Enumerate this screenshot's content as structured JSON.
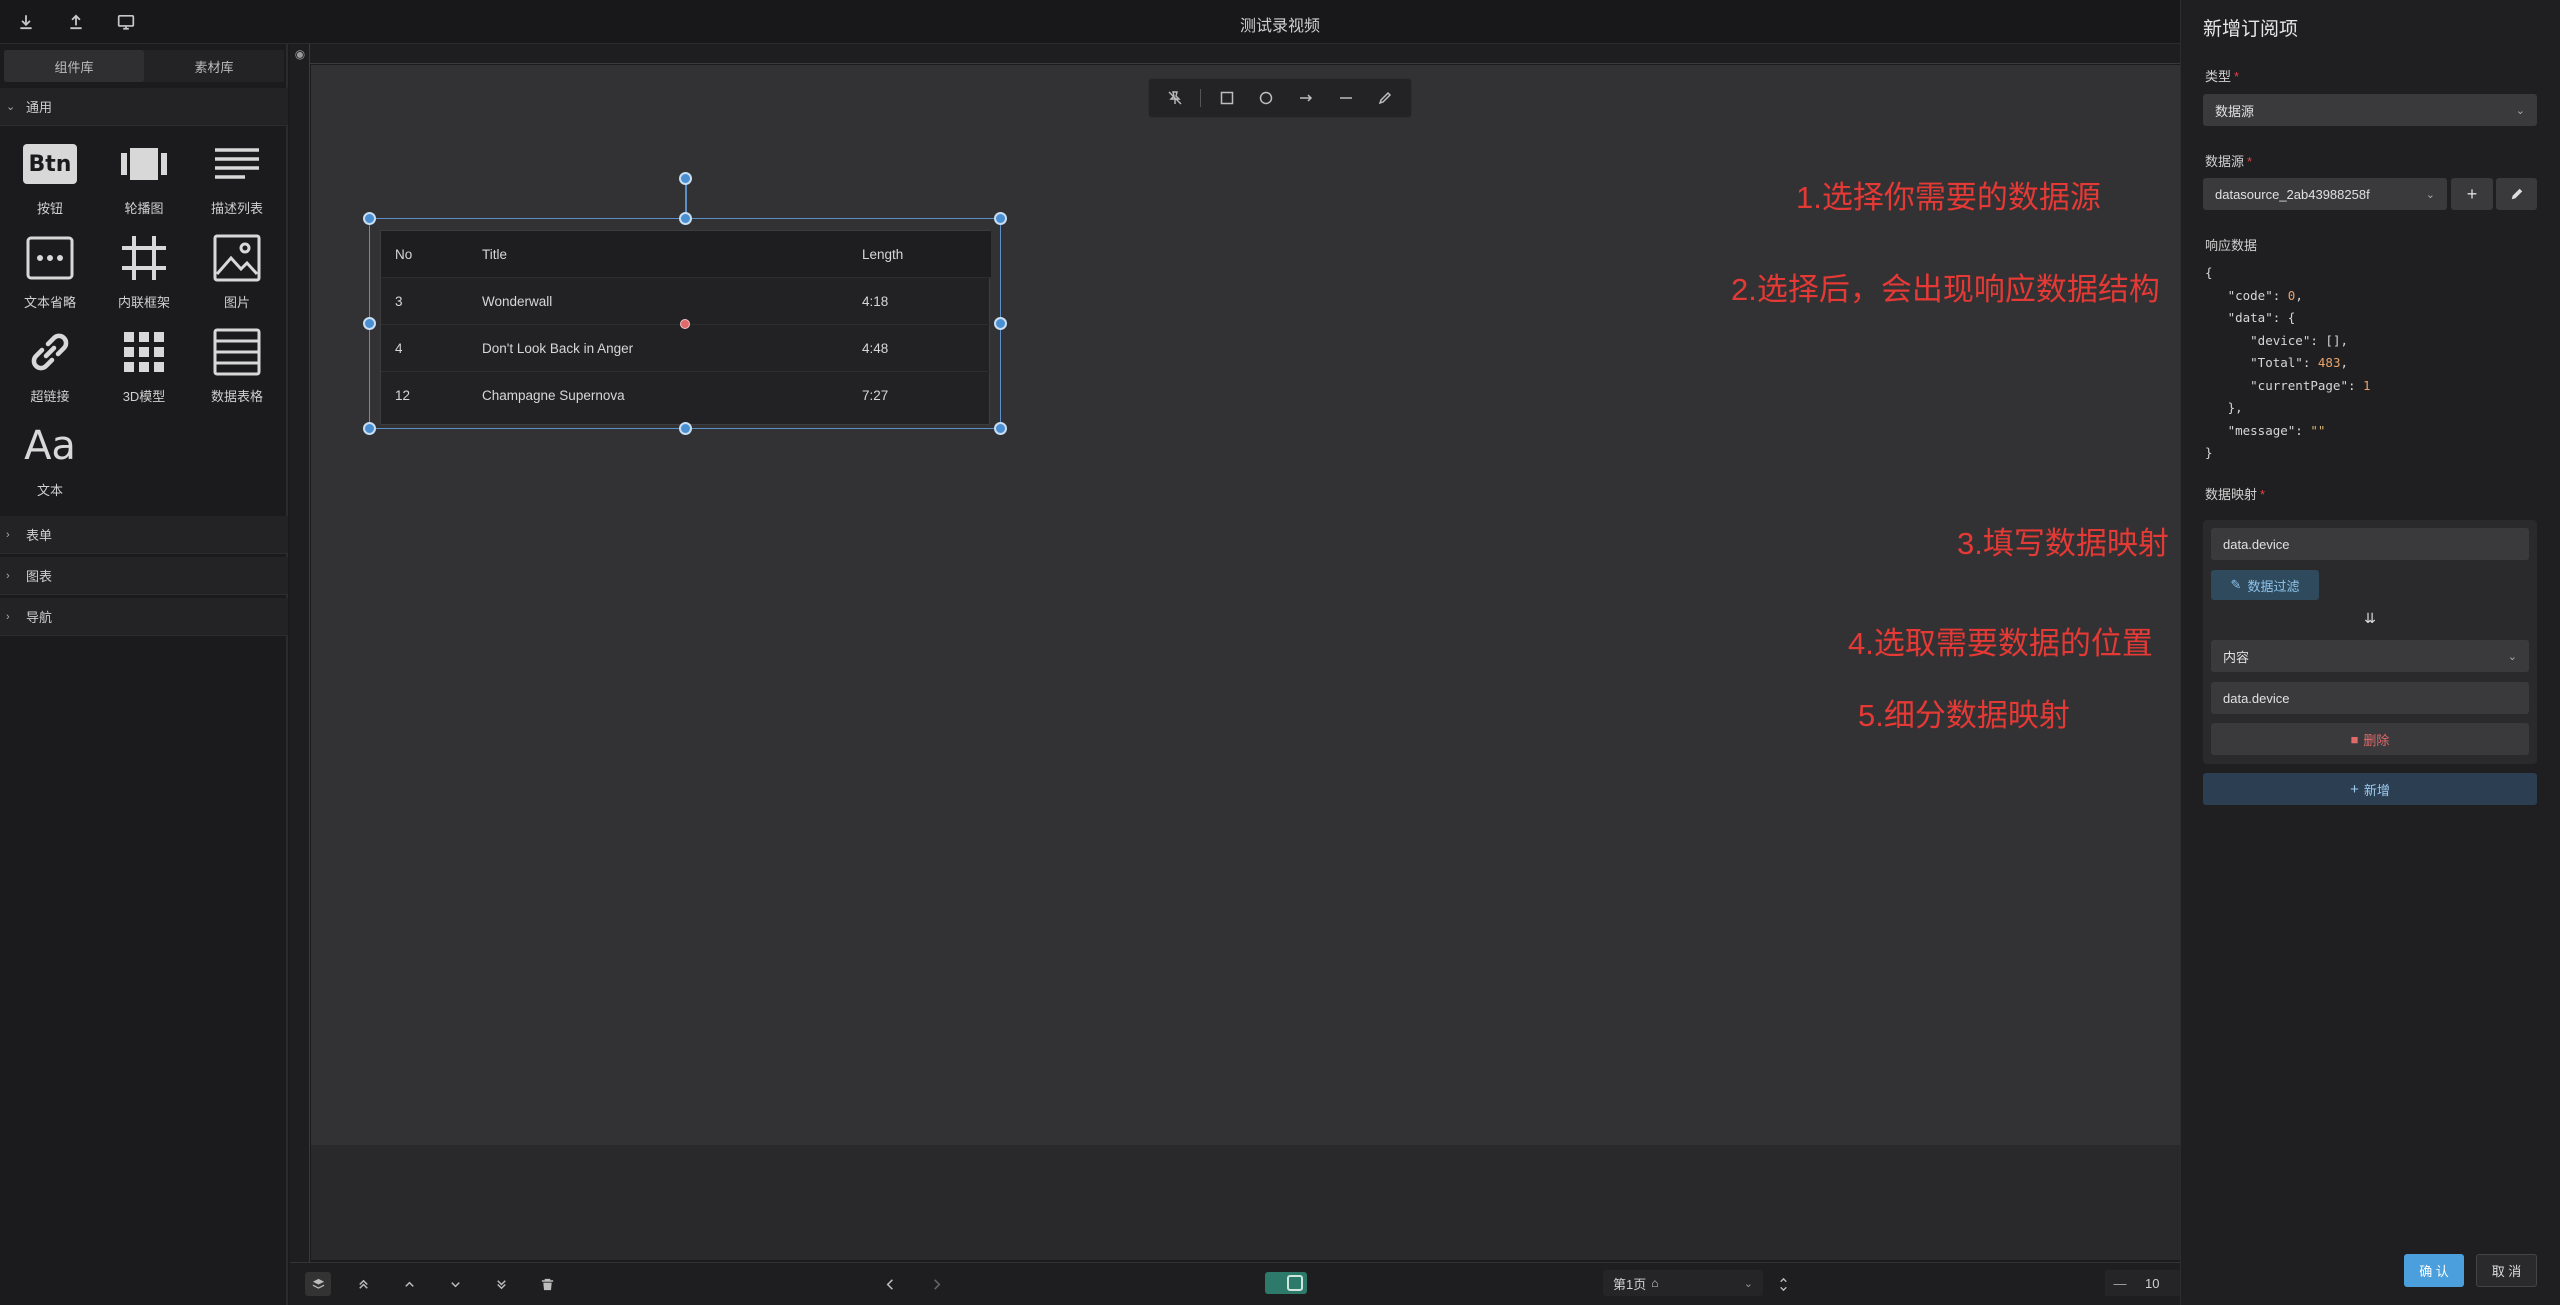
{
  "window": {
    "title": "测试录视频"
  },
  "toolbar": {
    "icons": [
      "download-icon",
      "upload-icon",
      "monitor-icon"
    ]
  },
  "sidebar": {
    "tabs": [
      {
        "label": "组件库",
        "active": true
      },
      {
        "label": "素材库",
        "active": false
      }
    ],
    "sections": [
      {
        "label": "通用",
        "expanded": true
      },
      {
        "label": "表单",
        "expanded": false
      },
      {
        "label": "图表",
        "expanded": false
      },
      {
        "label": "导航",
        "expanded": false
      }
    ],
    "components": [
      {
        "label": "按钮",
        "icon": "btn-icon"
      },
      {
        "label": "轮播图",
        "icon": "carousel-icon"
      },
      {
        "label": "描述列表",
        "icon": "description-list-icon"
      },
      {
        "label": "文本省略",
        "icon": "text-ellipsis-icon"
      },
      {
        "label": "内联框架",
        "icon": "iframe-icon"
      },
      {
        "label": "图片",
        "icon": "image-icon"
      },
      {
        "label": "超链接",
        "icon": "link-icon"
      },
      {
        "label": "3D模型",
        "icon": "grid-3d-icon"
      },
      {
        "label": "数据表格",
        "icon": "data-table-icon"
      },
      {
        "label": "文本",
        "icon": "text-icon"
      }
    ],
    "btn_icon_text": "Btn",
    "text_icon_text": "Aa"
  },
  "canvas": {
    "draw_tools": [
      "pin-off-icon",
      "rectangle-icon",
      "circle-icon",
      "arrow-icon",
      "line-icon",
      "pen-icon"
    ],
    "table": {
      "headers": [
        "No",
        "Title",
        "Length"
      ],
      "rows": [
        [
          "3",
          "Wonderwall",
          "4:18"
        ],
        [
          "4",
          "Don't Look Back in Anger",
          "4:48"
        ],
        [
          "12",
          "Champagne Supernova",
          "7:27"
        ]
      ]
    },
    "annotations": [
      "1.选择你需要的数据源",
      "2.选择后，会出现响应数据结构",
      "3.填写数据映射",
      "4.选取需要数据的位置",
      "5.细分数据映射"
    ],
    "annotation_color": "#e53935"
  },
  "bottom": {
    "page_label": "第1页",
    "zoom_partial": "10",
    "zoom_minus": "—"
  },
  "panel": {
    "title": "新增订阅项",
    "type_label": "类型",
    "type_value": "数据源",
    "datasource_label": "数据源",
    "datasource_value": "datasource_2ab43988258f",
    "response_label": "响应数据",
    "response_json": {
      "code": 0,
      "device": "[]",
      "Total": 483,
      "currentPage": 1,
      "message": "\"\""
    },
    "mapping_label": "数据映射",
    "mapping_source": "data.device",
    "filter_btn": "数据过滤",
    "content_select": "内容",
    "mapping_target": "data.device",
    "delete_btn": "删除",
    "add_btn": "新增",
    "confirm_btn": "确 认",
    "cancel_btn": "取 消",
    "accent": "#4a9fdc"
  }
}
